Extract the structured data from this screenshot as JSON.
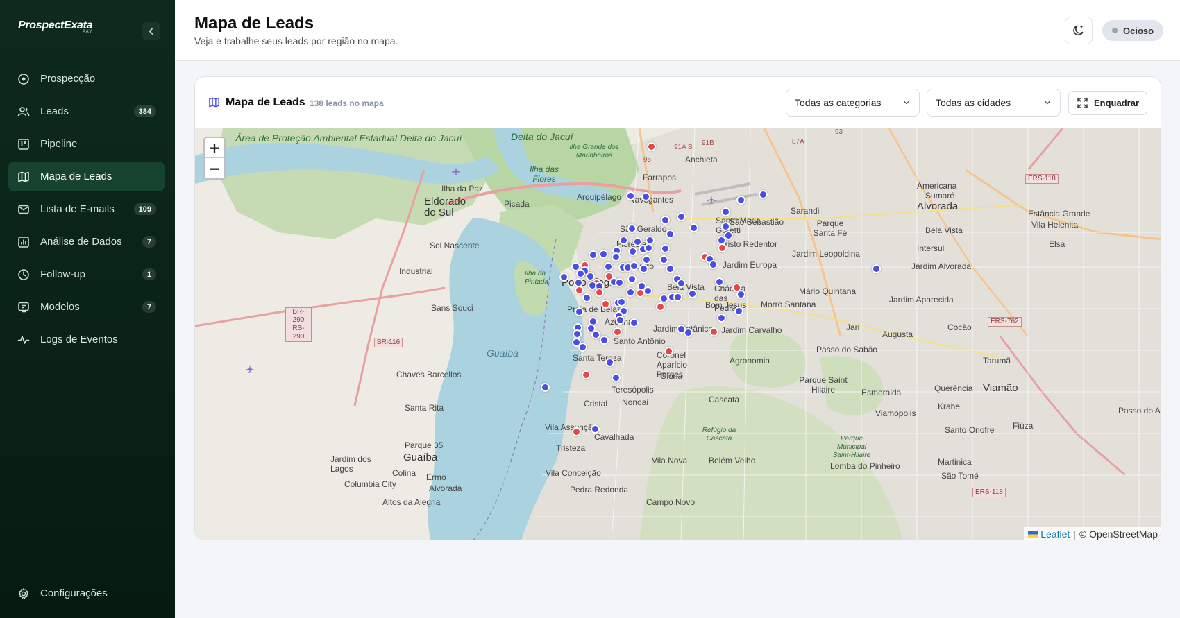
{
  "app": {
    "logo": "ProspectExata",
    "logo_sub": "PAY"
  },
  "sidebar": {
    "items": [
      {
        "label": "Prospecção",
        "icon": "target-icon",
        "badge": ""
      },
      {
        "label": "Leads",
        "icon": "users-icon",
        "badge": "384"
      },
      {
        "label": "Pipeline",
        "icon": "kanban-icon",
        "badge": ""
      },
      {
        "label": "Mapa de Leads",
        "icon": "map-icon",
        "badge": "",
        "active": true
      },
      {
        "label": "Lista de E-mails",
        "icon": "mail-icon",
        "badge": "109"
      },
      {
        "label": "Análise de Dados",
        "icon": "chart-icon",
        "badge": "7"
      },
      {
        "label": "Follow-up",
        "icon": "clock-icon",
        "badge": "1"
      },
      {
        "label": "Modelos",
        "icon": "template-icon",
        "badge": "7"
      },
      {
        "label": "Logs de Eventos",
        "icon": "activity-icon",
        "badge": ""
      }
    ],
    "settings_label": "Configurações"
  },
  "header": {
    "title": "Mapa de Leads",
    "subtitle": "Veja e trabalhe seus leads por região no mapa.",
    "status": "Ocioso"
  },
  "card": {
    "title": "Mapa de Leads",
    "count": "138 leads no mapa",
    "category_select": "Todas as categorias",
    "city_select": "Todas as cidades",
    "fit_button": "Enquadrar"
  },
  "map": {
    "zoom_in": "+",
    "zoom_out": "−",
    "attribution_leaflet": "Leaflet",
    "attribution_sep": "|",
    "attribution_osm": "© OpenStreetMap",
    "labels": {
      "area_protecao": "Área de Proteção Ambiental Estadual Delta do Jacuí",
      "delta_jacui": "Delta do Jacuí",
      "ilha_grande": "Ilha Grande dos Marinheiros",
      "ilha_flores": "Ilha das Flores",
      "ilha_paz": "Ilha da Paz",
      "eldorado": "Eldorado do Sul",
      "picada": "Picada",
      "arquipelago": "Arquipélago",
      "navegantes": "Navegantes",
      "farrapos": "Farrapos",
      "anchieta": "Anchieta",
      "sarandi": "Sarandi",
      "santa_maria": "Santa Maria Goretti",
      "sebastiao": "São Sebastião",
      "parque_santa_fe": "Parque Santa Fé",
      "alvorada": "Alvorada",
      "americana": "Americana",
      "sumare": "Sumaré",
      "estancia": "Estância Grande",
      "vila_helenita": "Vila Helenita",
      "bela_vista_alv": "Bela Vista",
      "intersul": "Intersul",
      "elsa": "Elsa",
      "leopoldina": "Jardim Leopoldina",
      "jardim_alvorada": "Jardim Alvorada",
      "sao_geraldo": "São Geraldo",
      "cristo_redentor": "Cristo Redentor",
      "jardim_europa": "Jardim Europa",
      "mario_quintana": "Mário Quintana",
      "jardim_aparecida": "Jardim Aparecida",
      "sol_nascente": "Sol Nascente",
      "industrial": "Industrial",
      "ilha_pintada": "Ilha da Pintada",
      "porto_alegre": "Porto Alegre",
      "floresta": "Floresta",
      "centro": "Centro",
      "bela_vista": "Bela Vista",
      "chacara": "Chácara das Pedras",
      "bom_jesus": "Bom Jesus",
      "morro_santana": "Morro Santana",
      "praia_belas": "Praia de Belas",
      "azenha": "Azenha",
      "jardim_botanico": "Jardim Botânico",
      "jardim_carvalho": "Jardim Carvalho",
      "jari": "Jari",
      "cocao": "Cocão",
      "augusta": "Augusta",
      "sans_souci": "Sans Souci",
      "guaiba_lake": "Guaíba",
      "santo_antonio": "Santo Antônio",
      "coronel_aparicio": "Coronel Aparício Borges",
      "agronomia": "Agronomia",
      "passo_sabao": "Passo do Sabão",
      "tarumã": "Tarumã",
      "santa_tereza": "Santa Tereza",
      "chaves_barcellos": "Chaves Barcellos",
      "gloria": "Glória",
      "teresopolis": "Teresópolis",
      "parque_saint_hilaire": "Parque Saint Hilaire",
      "esmeralda": "Esmeralda",
      "queréncia": "Querência",
      "viamao": "Viamão",
      "krahe": "Krahe",
      "passo_areia": "Passo do Ar",
      "santa_rita": "Santa Rita",
      "cristal": "Cristal",
      "nonoai": "Nonoai",
      "cascata": "Cascata",
      "viamopolis": "Viamópolis",
      "santo_onofre": "Santo Onofre",
      "fiuza": "Fiúza",
      "vila_assuncao": "Vila Assunção",
      "cavalhada": "Cavalhada",
      "tristeza": "Tristeza",
      "parque35": "Parque 35",
      "guaiba_city": "Guaíba",
      "jardim_lagos": "Jardim dos Lagos",
      "colina": "Colina",
      "ermo": "Ermo",
      "columbia": "Columbia City",
      "alvorada_g": "Alvorada",
      "vila_conceicao": "Vila Conceição",
      "pedra_redonda": "Pedra Redonda",
      "vila_nova": "Vila Nova",
      "belem_velho": "Belém Velho",
      "lomba": "Lomba do Pinheiro",
      "martinica": "Martinica",
      "sao_tome": "São Tomé",
      "altos": "Altos da Alegria",
      "campo_novo": "Campo Novo",
      "refugio": "Refúgio da Cascata",
      "parque_saint_hilaire_green": "Parque Municipal Saint-Hilaire"
    },
    "shields": [
      "BR-290",
      "RS-290",
      "BR-116",
      "ERS-118",
      "ERS-762",
      "ERS-118",
      "91A B",
      "87A",
      "95",
      "93",
      "91B"
    ],
    "marker_colors": {
      "blue": "#4b4de6",
      "red": "#e7474b"
    },
    "markers": [
      [
        "blue",
        907,
        281
      ],
      [
        "blue",
        929,
        282
      ],
      [
        "red",
        937,
        210
      ],
      [
        "blue",
        1066,
        287
      ],
      [
        "blue",
        1098,
        279
      ],
      [
        "blue",
        1044,
        304
      ],
      [
        "blue",
        980,
        311
      ],
      [
        "blue",
        957,
        316
      ],
      [
        "blue",
        998,
        327
      ],
      [
        "blue",
        1044,
        325
      ],
      [
        "blue",
        909,
        328
      ],
      [
        "blue",
        964,
        336
      ],
      [
        "blue",
        1048,
        338
      ],
      [
        "blue",
        897,
        345
      ],
      [
        "blue",
        917,
        347
      ],
      [
        "blue",
        935,
        345
      ],
      [
        "blue",
        1038,
        345
      ],
      [
        "red",
        1039,
        356
      ],
      [
        "blue",
        887,
        360
      ],
      [
        "blue",
        910,
        361
      ],
      [
        "blue",
        925,
        358
      ],
      [
        "blue",
        933,
        356
      ],
      [
        "blue",
        957,
        357
      ],
      [
        "blue",
        868,
        365
      ],
      [
        "blue",
        853,
        366
      ],
      [
        "blue",
        886,
        369
      ],
      [
        "blue",
        930,
        373
      ],
      [
        "blue",
        955,
        373
      ],
      [
        "red",
        1014,
        369
      ],
      [
        "blue",
        1021,
        372
      ],
      [
        "blue",
        1026,
        380
      ],
      [
        "blue",
        964,
        386
      ],
      [
        "blue",
        828,
        383
      ],
      [
        "red",
        841,
        381
      ],
      [
        "blue",
        841,
        389
      ],
      [
        "blue",
        875,
        383
      ],
      [
        "blue",
        896,
        384
      ],
      [
        "blue",
        903,
        384
      ],
      [
        "blue",
        912,
        382
      ],
      [
        "blue",
        926,
        386
      ],
      [
        "blue",
        835,
        393
      ],
      [
        "blue",
        811,
        398
      ],
      [
        "blue",
        849,
        397
      ],
      [
        "red",
        876,
        397
      ],
      [
        "blue",
        909,
        401
      ],
      [
        "blue",
        974,
        401
      ],
      [
        "blue",
        832,
        406
      ],
      [
        "red",
        858,
        407
      ],
      [
        "blue",
        852,
        410
      ],
      [
        "blue",
        883,
        405
      ],
      [
        "blue",
        891,
        406
      ],
      [
        "blue",
        923,
        411
      ],
      [
        "blue",
        1035,
        405
      ],
      [
        "red",
        1060,
        413
      ],
      [
        "blue",
        862,
        411
      ],
      [
        "red",
        862,
        420
      ],
      [
        "blue",
        907,
        420
      ],
      [
        "blue",
        932,
        418
      ],
      [
        "red",
        921,
        421
      ],
      [
        "blue",
        980,
        407
      ],
      [
        "blue",
        844,
        428
      ],
      [
        "red",
        871,
        437
      ],
      [
        "blue",
        955,
        429
      ],
      [
        "blue",
        967,
        427
      ],
      [
        "blue",
        975,
        427
      ],
      [
        "blue",
        996,
        422
      ],
      [
        "blue",
        1066,
        423
      ],
      [
        "red",
        833,
        417
      ],
      [
        "blue",
        889,
        435
      ],
      [
        "blue",
        894,
        434
      ],
      [
        "red",
        950,
        441
      ],
      [
        "blue",
        833,
        448
      ],
      [
        "blue",
        897,
        447
      ],
      [
        "blue",
        890,
        454
      ],
      [
        "blue",
        1063,
        447
      ],
      [
        "blue",
        853,
        462
      ],
      [
        "blue",
        892,
        460
      ],
      [
        "blue",
        912,
        464
      ],
      [
        "blue",
        1038,
        457
      ],
      [
        "blue",
        831,
        471
      ],
      [
        "blue",
        850,
        472
      ],
      [
        "red",
        888,
        477
      ],
      [
        "blue",
        980,
        473
      ],
      [
        "blue",
        990,
        478
      ],
      [
        "red",
        1027,
        477
      ],
      [
        "blue",
        830,
        480
      ],
      [
        "blue",
        857,
        481
      ],
      [
        "blue",
        869,
        489
      ],
      [
        "blue",
        829,
        492
      ],
      [
        "blue",
        838,
        499
      ],
      [
        "red",
        962,
        505
      ],
      [
        "blue",
        877,
        521
      ],
      [
        "red",
        843,
        539
      ],
      [
        "blue",
        886,
        543
      ],
      [
        "blue",
        784,
        557
      ],
      [
        "blue",
        856,
        617
      ],
      [
        "red",
        829,
        621
      ],
      [
        "blue",
        1261,
        386
      ]
    ]
  }
}
